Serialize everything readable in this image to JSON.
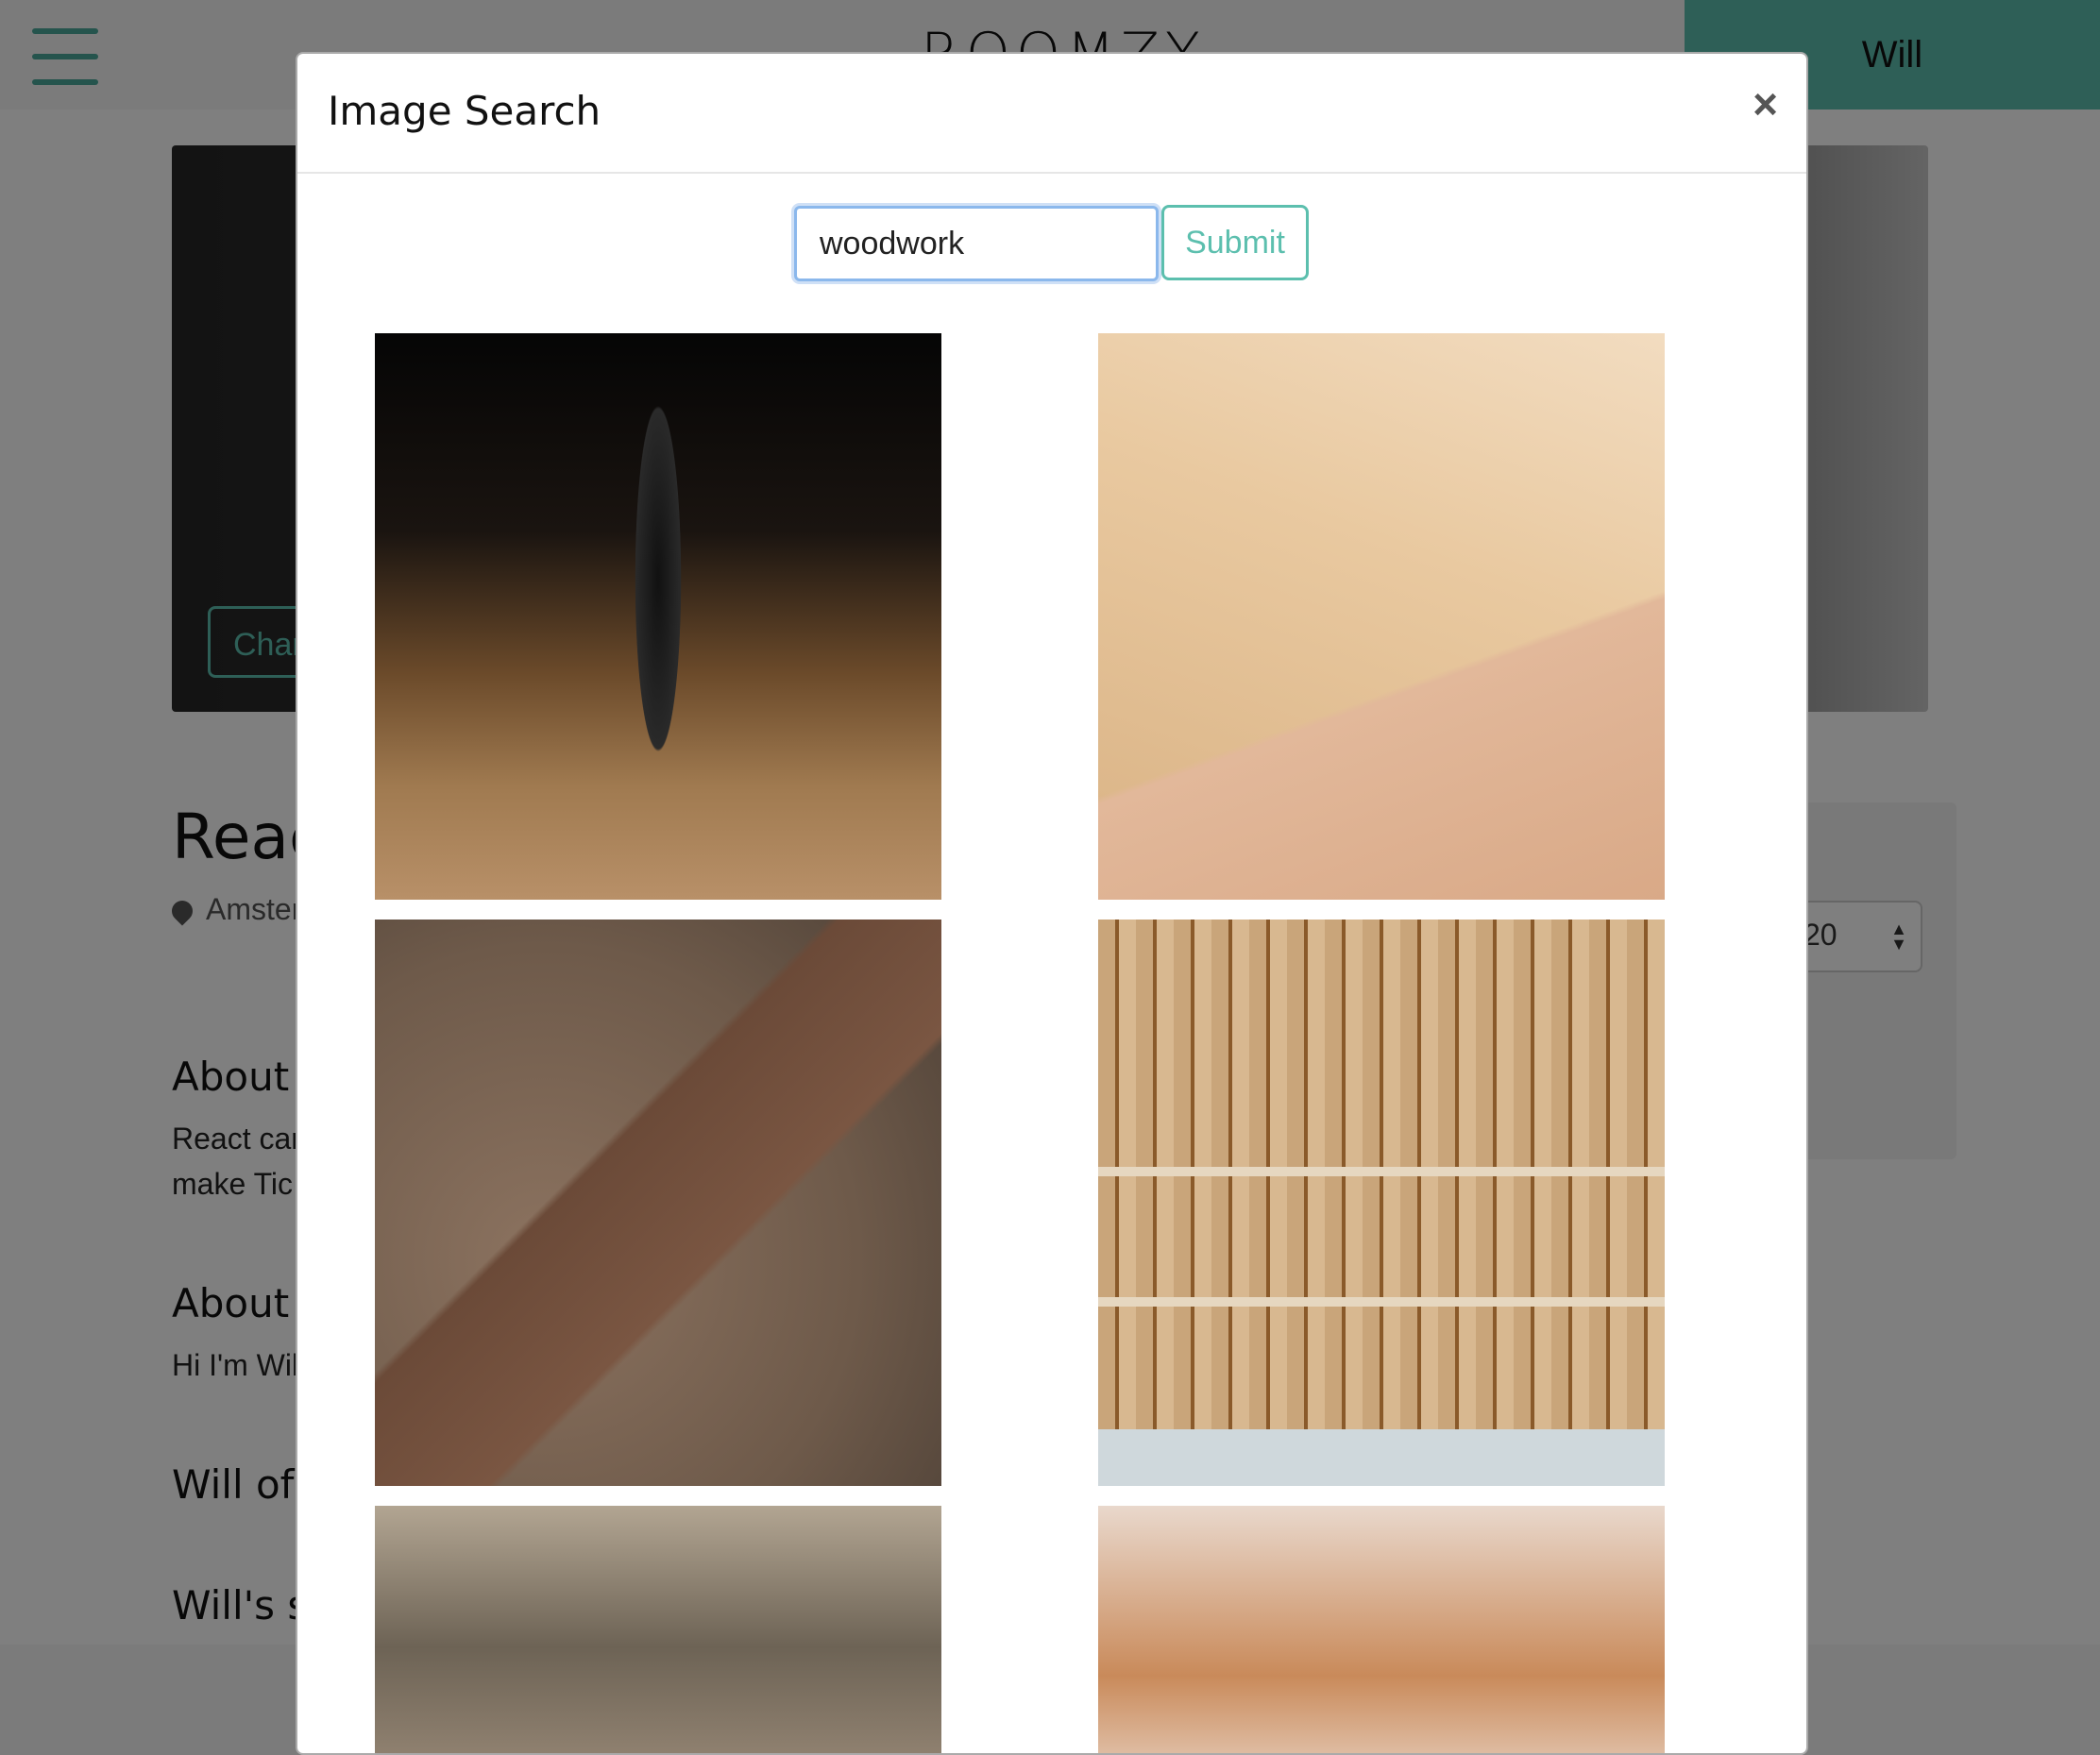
{
  "navbar": {
    "brand": "ROOMZY",
    "user_label": "Will"
  },
  "background": {
    "hero_change_button": "Char",
    "title": "Reac",
    "location": "Amster",
    "date_value": "20",
    "sections": [
      {
        "heading": "About",
        "text": [
          "React car",
          "make Tic"
        ]
      },
      {
        "heading": "About",
        "text": [
          "Hi I'm Wil"
        ]
      },
      {
        "heading": "Will of",
        "text": []
      },
      {
        "heading": "Will's s",
        "text": []
      }
    ]
  },
  "modal": {
    "title": "Image Search",
    "close_label": "×",
    "search": {
      "value": "woodwork",
      "placeholder": ""
    },
    "submit_label": "Submit",
    "results": [
      {
        "name": "drill-bit-in-wood"
      },
      {
        "name": "chisel-carving-wood"
      },
      {
        "name": "sanding-wood-plank"
      },
      {
        "name": "tool-wall-rack"
      },
      {
        "name": "woodworking-partial-1"
      },
      {
        "name": "woodworking-partial-2"
      }
    ]
  },
  "colors": {
    "accent": "#5cbfae",
    "overlay": "rgba(0,0,0,0.5)",
    "input_focus": "#8bb8ec"
  }
}
